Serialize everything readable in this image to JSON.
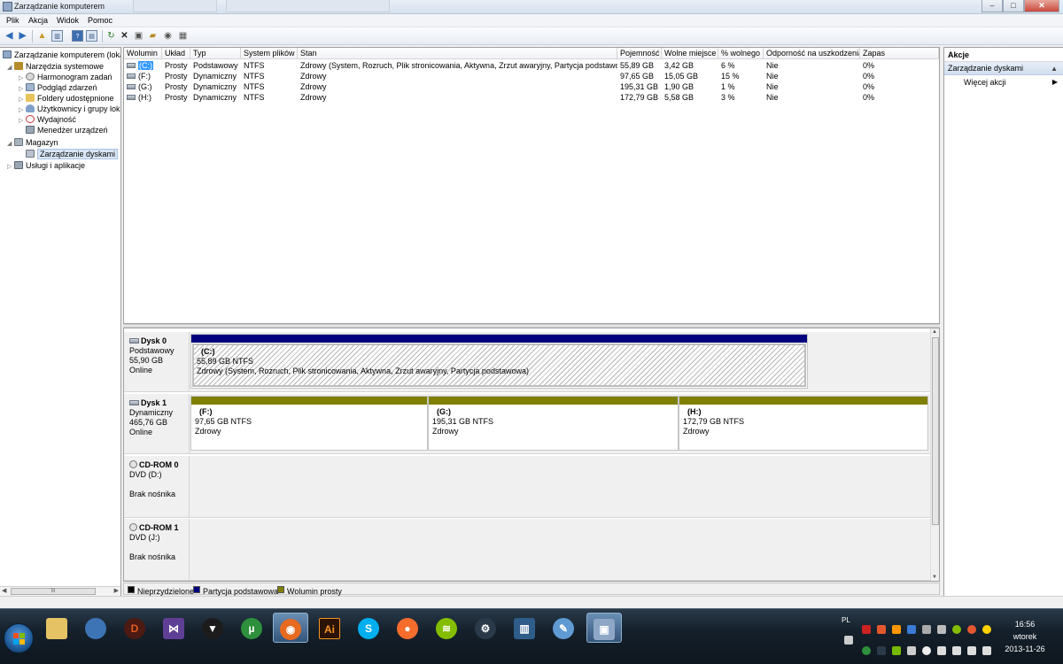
{
  "window": {
    "title": "Zarządzanie komputerem",
    "buttons": {
      "minimize": "–",
      "maximize": "□",
      "close": "✕"
    }
  },
  "menu": [
    "Plik",
    "Akcja",
    "Widok",
    "Pomoc"
  ],
  "tree": {
    "items": [
      {
        "label": "Zarządzanie komputerem (loka",
        "level": 0,
        "exp": ""
      },
      {
        "label": "Narzędzia systemowe",
        "level": 1,
        "exp": "◢"
      },
      {
        "label": "Harmonogram zadań",
        "level": 2,
        "exp": "▷"
      },
      {
        "label": "Podgląd zdarzeń",
        "level": 2,
        "exp": "▷"
      },
      {
        "label": "Foldery udostępnione",
        "level": 2,
        "exp": "▷"
      },
      {
        "label": "Użytkownicy i grupy lok",
        "level": 2,
        "exp": "▷"
      },
      {
        "label": "Wydajność",
        "level": 2,
        "exp": "▷"
      },
      {
        "label": "Menedżer urządzeń",
        "level": 2,
        "exp": ""
      },
      {
        "label": "Magazyn",
        "level": 1,
        "exp": "◢"
      },
      {
        "label": "Zarządzanie dyskami",
        "level": 2,
        "exp": "",
        "selected": true
      },
      {
        "label": "Usługi i aplikacje",
        "level": 1,
        "exp": "▷"
      }
    ],
    "scroll_grip": "III"
  },
  "volumes": {
    "columns": [
      "Wolumin",
      "Układ",
      "Typ",
      "System plików",
      "Stan",
      "Pojemność",
      "Wolne miejsce",
      "% wolnego",
      "Odporność na uszkodzenia",
      "Zapas"
    ],
    "rows": [
      [
        "(C:)",
        "Prosty",
        "Podstawowy",
        "NTFS",
        "Zdrowy (System, Rozruch, Plik stronicowania, Aktywna, Zrzut awaryjny, Partycja podstawowa)",
        "55,89 GB",
        "3,42 GB",
        "6 %",
        "Nie",
        "0%"
      ],
      [
        "(F:)",
        "Prosty",
        "Dynamiczny",
        "NTFS",
        "Zdrowy",
        "97,65 GB",
        "15,05 GB",
        "15 %",
        "Nie",
        "0%"
      ],
      [
        "(G:)",
        "Prosty",
        "Dynamiczny",
        "NTFS",
        "Zdrowy",
        "195,31 GB",
        "1,90 GB",
        "1 %",
        "Nie",
        "0%"
      ],
      [
        "(H:)",
        "Prosty",
        "Dynamiczny",
        "NTFS",
        "Zdrowy",
        "172,79 GB",
        "5,58 GB",
        "3 %",
        "Nie",
        "0%"
      ]
    ]
  },
  "disks": [
    {
      "name": "Dysk 0",
      "type": "Podstawowy",
      "size": "55,90 GB",
      "status": "Online",
      "partitions": [
        {
          "letter": "(C:)",
          "size": "55,89 GB NTFS",
          "state": "Zdrowy (System, Rozruch, Plik stronicowania, Aktywna, Zrzut awaryjny, Partycja podstawowa)"
        }
      ]
    },
    {
      "name": "Dysk 1",
      "type": "Dynamiczny",
      "size": "465,76 GB",
      "status": "Online",
      "partitions": [
        {
          "letter": "(F:)",
          "size": "97,65 GB NTFS",
          "state": "Zdrowy"
        },
        {
          "letter": "(G:)",
          "size": "195,31 GB NTFS",
          "state": "Zdrowy"
        },
        {
          "letter": "(H:)",
          "size": "172,79 GB NTFS",
          "state": "Zdrowy"
        }
      ]
    },
    {
      "name": "CD-ROM 0",
      "type": "DVD (D:)",
      "status": "Brak nośnika"
    },
    {
      "name": "CD-ROM 1",
      "type": "DVD (J:)",
      "status": "Brak nośnika"
    }
  ],
  "legend": [
    {
      "label": "Nieprzydzielone",
      "color": "#000000"
    },
    {
      "label": "Partycja podstawowa",
      "color": "#00007f"
    },
    {
      "label": "Wolumin prosty",
      "color": "#808000"
    }
  ],
  "actions": {
    "header": "Akcje",
    "section": "Zarządzanie dyskami",
    "item": "Więcej akcji"
  },
  "taskbar": {
    "apps": [
      "explorer",
      "thunderbird",
      "diablo",
      "vs",
      "foobar",
      "utorrent",
      "firefox",
      "illustrator",
      "skype",
      "origin",
      "spotify",
      "steam",
      "taskman",
      "paint",
      "mgmt"
    ],
    "language": "PL",
    "time": "16:56",
    "day": "wtorek",
    "date": "2013-11-26"
  },
  "colors": {
    "primary_partition": "#00007f",
    "simple_volume": "#808000",
    "selection": "#3399ff"
  }
}
